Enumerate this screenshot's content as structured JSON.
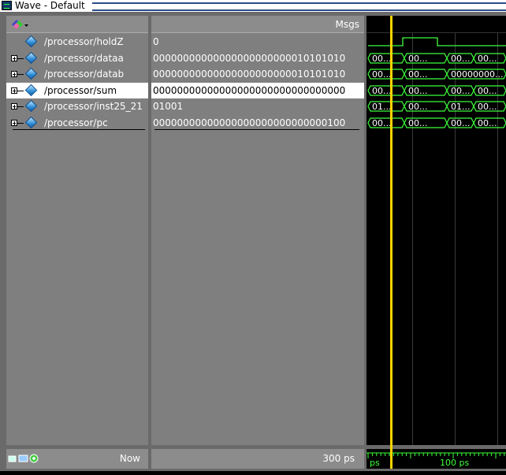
{
  "window": {
    "title": "Wave - Default"
  },
  "header": {
    "msgs_label": "Msgs"
  },
  "signals": [
    {
      "name": "/processor/holdZ",
      "value": "0",
      "expandable": false,
      "selected": false
    },
    {
      "name": "/processor/dataa",
      "value": "00000000000000000000000010101010",
      "expandable": true,
      "selected": false
    },
    {
      "name": "/processor/datab",
      "value": "00000000000000000000000010101010",
      "expandable": true,
      "selected": false
    },
    {
      "name": "/processor/sum",
      "value": "00000000000000000000000000000000",
      "expandable": true,
      "selected": true
    },
    {
      "name": "/processor/inst25_21",
      "value": "01001",
      "expandable": true,
      "selected": false
    },
    {
      "name": "/processor/pc",
      "value": "00000000000000000000000000000100",
      "expandable": true,
      "selected": false
    }
  ],
  "wave_labels": [
    [
      "00...",
      "00...",
      "00...",
      "00..."
    ],
    [
      "00...",
      "00...",
      "00000000...",
      ""
    ],
    [
      "00...",
      "00...",
      "00...",
      "00..."
    ],
    [
      "01...",
      "00...",
      "01...",
      "00..."
    ],
    [
      "00...",
      "00...",
      "00...",
      "00..."
    ]
  ],
  "footer": {
    "now_label": "Now",
    "now_value": "300 ps",
    "ruler_left": "ps",
    "ruler_mid": "100 ps"
  },
  "colors": {
    "wave_green": "#3cff3c",
    "cursor": "#ffd400",
    "grid": "#3a3a3a"
  }
}
